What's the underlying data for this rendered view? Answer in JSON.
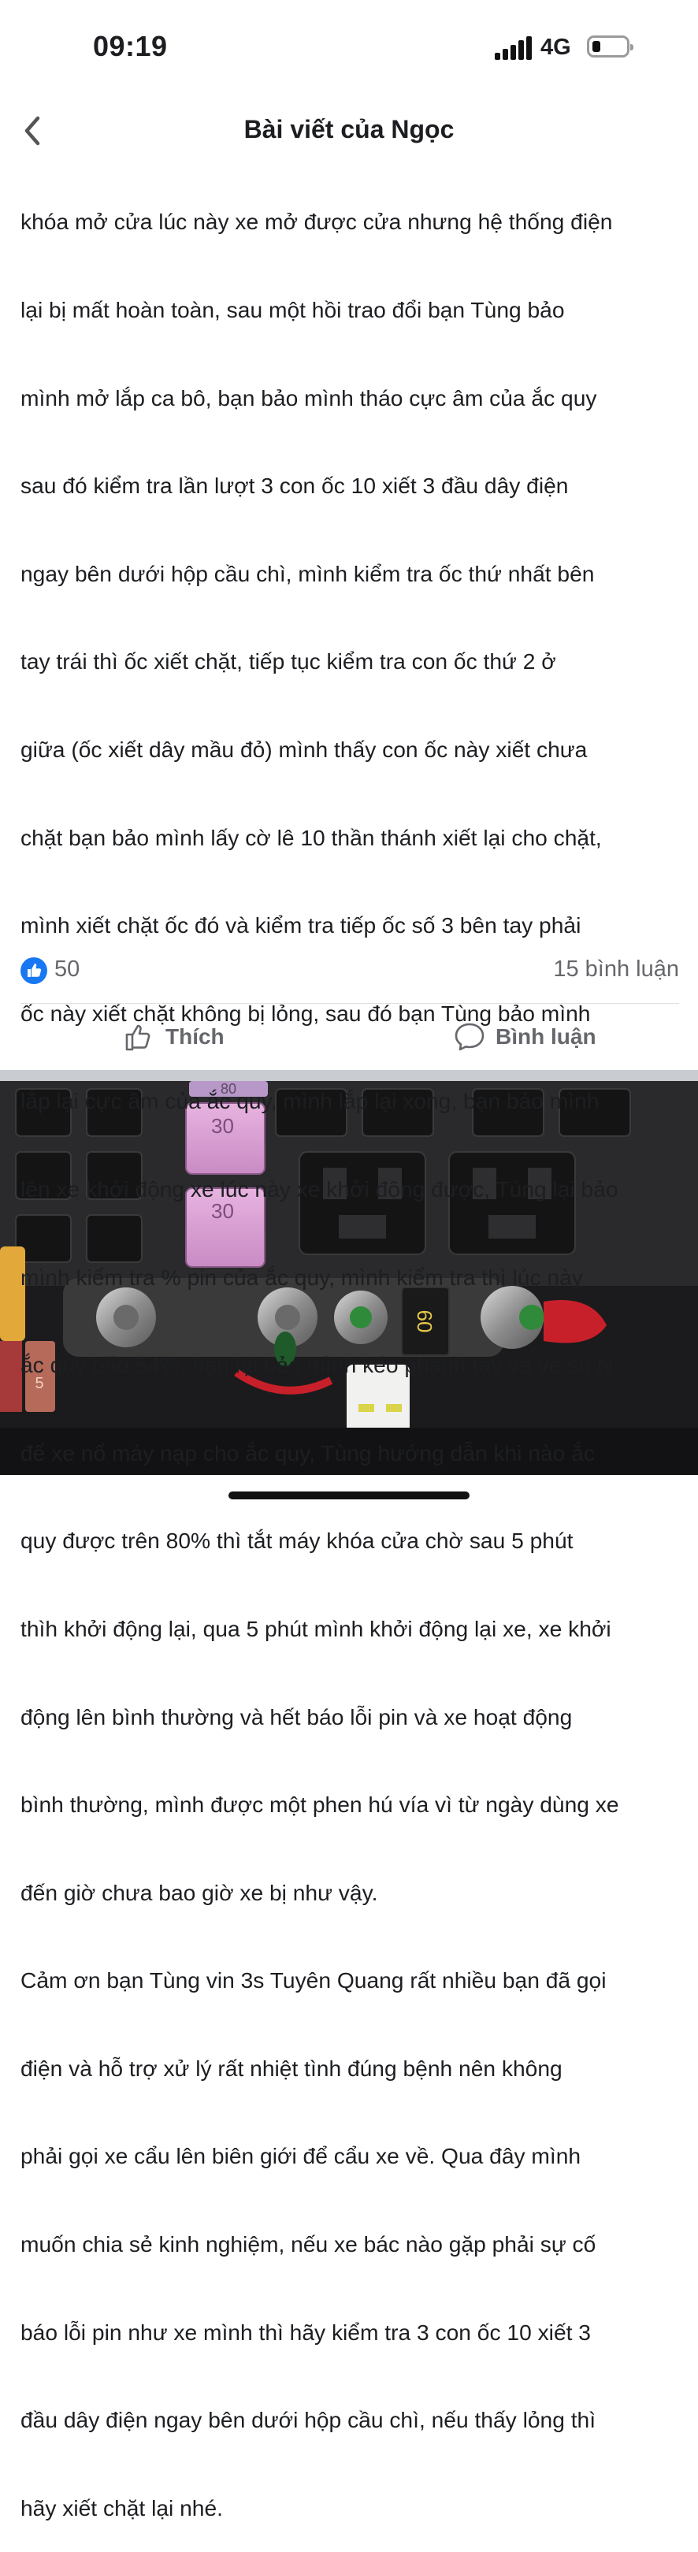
{
  "status_bar": {
    "time": "09:19",
    "network": "4G",
    "battery_icon": "battery-low-icon",
    "signal_icon": "signal-bars-icon"
  },
  "header": {
    "title": "Bài viết của Ngọc",
    "back_icon": "chevron-left-icon"
  },
  "post": {
    "lines": [
      "khóa mở cửa lúc này xe mở được cửa nhưng hệ thống điện",
      "lại bị mất hoàn toàn, sau một hồi trao đổi bạn Tùng bảo",
      "mình mở lắp ca bô, bạn bảo mình tháo cực âm của ắc quy",
      "sau đó kiểm tra lần lượt 3 con ốc 10 xiết 3 đầu dây điện",
      "ngay bên dưới hộp cầu chì, mình kiểm tra ốc thứ nhất bên",
      "tay trái thì ốc xiết chặt, tiếp tục kiểm tra con ốc thứ 2 ở",
      "giữa (ốc xiết dây mầu đỏ) mình thấy con ốc này xiết chưa",
      "chặt bạn bảo mình lấy cờ lê 10 thần thánh xiết lại cho chặt,",
      "mình xiết chặt ốc đó và kiểm tra tiếp ốc số 3 bên tay phải",
      "ốc này xiết chặt không bị lỏng, sau đó bạn Tùng bảo mình",
      "lắp lại cực âm của ắc quy, mình lắp lại xong, bạn bảo mình",
      "lên xe khởi động xe lúc này xe khởi động được, Tùng lại bảo",
      "mình kiểm tra % pin của ắc quy, mình kiểm tra thì lúc này",
      "ắc quy báo 54%, bạn lại bảo mình kéo phanh tay và về số N",
      "để xe nổ máy nạp cho ắc quy, Tùng hướng dẫn khi nào ắc",
      "quy được trên 80% thì tắt máy khóa cửa chờ sau 5 phút",
      "thìh khởi động lại, qua 5 phút mình khởi động lại xe, xe khởi",
      "động lên bình thường và hết báo lỗi pin và xe hoạt động",
      "bình thường, mình được một phen hú vía vì từ ngày dùng xe",
      "đến giờ chưa bao giờ xe bị như vậy.",
      " Cảm ơn bạn Tùng vin 3s Tuyên Quang rất nhiều bạn đã gọi",
      "điện và hỗ trợ xử lý rất nhiệt tình đúng bệnh nên không",
      "phải gọi xe cẩu lên biên giới để cẩu xe về. Qua đây mình",
      "muốn chia sẻ kinh nghiệm, nếu xe bác nào gặp phải sự cố",
      "báo lỗi pin như xe mình thì hãy kiểm tra 3 con ốc 10 xiết 3",
      "đầu dây điện ngay bên dưới hộp cầu chì, nếu thấy lỏng thì",
      "hãy xiết chặt lại nhé."
    ]
  },
  "reactions": {
    "like_count": "50",
    "comment_count": "15 bình luận"
  },
  "actions": {
    "like_label": "Thích",
    "comment_label": "Bình luận"
  },
  "photo": {
    "fuse_labels": [
      "30",
      "30"
    ],
    "fuse_top_label": "80",
    "mega_fuse_label": "60",
    "fuse_small_label": "5"
  }
}
